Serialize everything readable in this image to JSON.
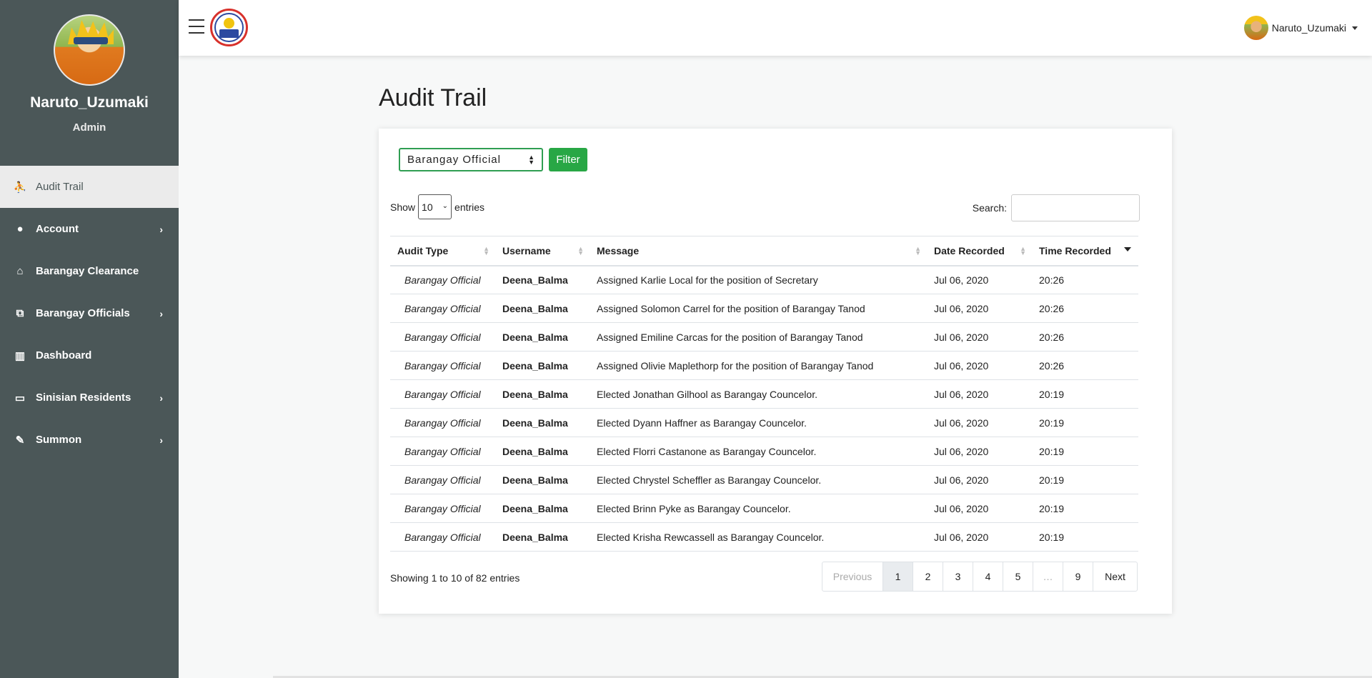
{
  "sidebar": {
    "profile_name": "Naruto_Uzumaki",
    "profile_role": "Admin",
    "items": [
      {
        "label": "Audit Trail",
        "icon": "audit-icon",
        "has_submenu": false,
        "active": true
      },
      {
        "label": "Account",
        "icon": "user-icon",
        "has_submenu": true,
        "active": false
      },
      {
        "label": "Barangay Clearance",
        "icon": "clearance-icon",
        "has_submenu": false,
        "active": false
      },
      {
        "label": "Barangay Officials",
        "icon": "sitemap-icon",
        "has_submenu": true,
        "active": false
      },
      {
        "label": "Dashboard",
        "icon": "chart-icon",
        "has_submenu": false,
        "active": false
      },
      {
        "label": "Sinisian Residents",
        "icon": "id-card-icon",
        "has_submenu": true,
        "active": false
      },
      {
        "label": "Summon",
        "icon": "edit-icon",
        "has_submenu": true,
        "active": false
      }
    ]
  },
  "topbar": {
    "user_name": "Naruto_Uzumaki"
  },
  "main": {
    "title": "Audit Trail",
    "filter": {
      "selected": "Barangay Official",
      "button_label": "Filter"
    },
    "length": {
      "show_label": "Show",
      "value": "10",
      "entries_label": "entries"
    },
    "search": {
      "label": "Search:",
      "value": ""
    },
    "table": {
      "headers": [
        "Audit Type",
        "Username",
        "Message",
        "Date Recorded",
        "Time Recorded"
      ],
      "rows": [
        [
          "Barangay Official",
          "Deena_Balma",
          "Assigned Karlie Local for the position of Secretary",
          "Jul 06, 2020",
          "20:26"
        ],
        [
          "Barangay Official",
          "Deena_Balma",
          "Assigned Solomon Carrel for the position of Barangay Tanod",
          "Jul 06, 2020",
          "20:26"
        ],
        [
          "Barangay Official",
          "Deena_Balma",
          "Assigned Emiline Carcas for the position of Barangay Tanod",
          "Jul 06, 2020",
          "20:26"
        ],
        [
          "Barangay Official",
          "Deena_Balma",
          "Assigned Olivie Maplethorp for the position of Barangay Tanod",
          "Jul 06, 2020",
          "20:26"
        ],
        [
          "Barangay Official",
          "Deena_Balma",
          "Elected Jonathan Gilhool as Barangay Councelor.",
          "Jul 06, 2020",
          "20:19"
        ],
        [
          "Barangay Official",
          "Deena_Balma",
          "Elected Dyann Haffner as Barangay Councelor.",
          "Jul 06, 2020",
          "20:19"
        ],
        [
          "Barangay Official",
          "Deena_Balma",
          "Elected Florri Castanone as Barangay Councelor.",
          "Jul 06, 2020",
          "20:19"
        ],
        [
          "Barangay Official",
          "Deena_Balma",
          "Elected Chrystel Scheffler as Barangay Councelor.",
          "Jul 06, 2020",
          "20:19"
        ],
        [
          "Barangay Official",
          "Deena_Balma",
          "Elected Brinn Pyke as Barangay Councelor.",
          "Jul 06, 2020",
          "20:19"
        ],
        [
          "Barangay Official",
          "Deena_Balma",
          "Elected Krisha Rewcassell as Barangay Councelor.",
          "Jul 06, 2020",
          "20:19"
        ]
      ]
    },
    "info": "Showing 1 to 10 of 82 entries",
    "pagination": {
      "previous": "Previous",
      "pages": [
        "1",
        "2",
        "3",
        "4",
        "5",
        "…",
        "9"
      ],
      "current": "1",
      "next": "Next"
    }
  },
  "colors": {
    "sidebar_bg": "#4b5758",
    "accent_green": "#28a745",
    "active_nav_bg": "#ebebeb"
  }
}
